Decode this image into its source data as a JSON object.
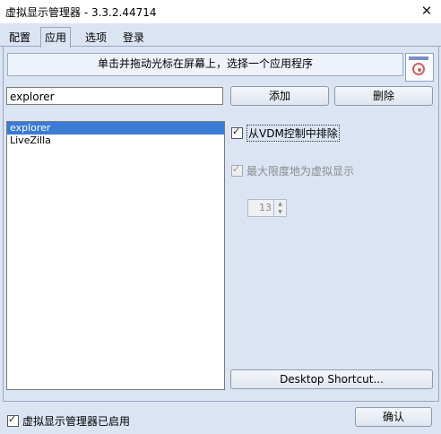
{
  "window": {
    "title": "虚拟显示管理器 - 3.3.2.44714",
    "close_glyph": "✕"
  },
  "tabs": [
    {
      "label": "配置"
    },
    {
      "label": "应用"
    },
    {
      "label": "选项"
    },
    {
      "label": "登录"
    }
  ],
  "apps_panel": {
    "instruction": "单击并拖动光标在屏幕上，选择一个应用程序",
    "target_icon": "crosshair-target-icon",
    "input_value": "explorer",
    "add_button": "添加",
    "delete_button": "删除",
    "apps": [
      "explorer",
      "LiveZilla"
    ],
    "selected_app": "explorer",
    "exclude_label": "从VDM控制中排除",
    "exclude_checked": true,
    "maximize_label": "最大限度地为虚拟显示",
    "maximize_checked": true,
    "spinner_value": "13",
    "desktop_shortcut_button": "Desktop Shortcut..."
  },
  "footer": {
    "enabled_label": "虚拟显示管理器已启用",
    "enabled_checked": true,
    "ok_button": "确认"
  },
  "colors": {
    "selection": "#3a7bd5",
    "panel_bg": "#dbe4f3"
  }
}
